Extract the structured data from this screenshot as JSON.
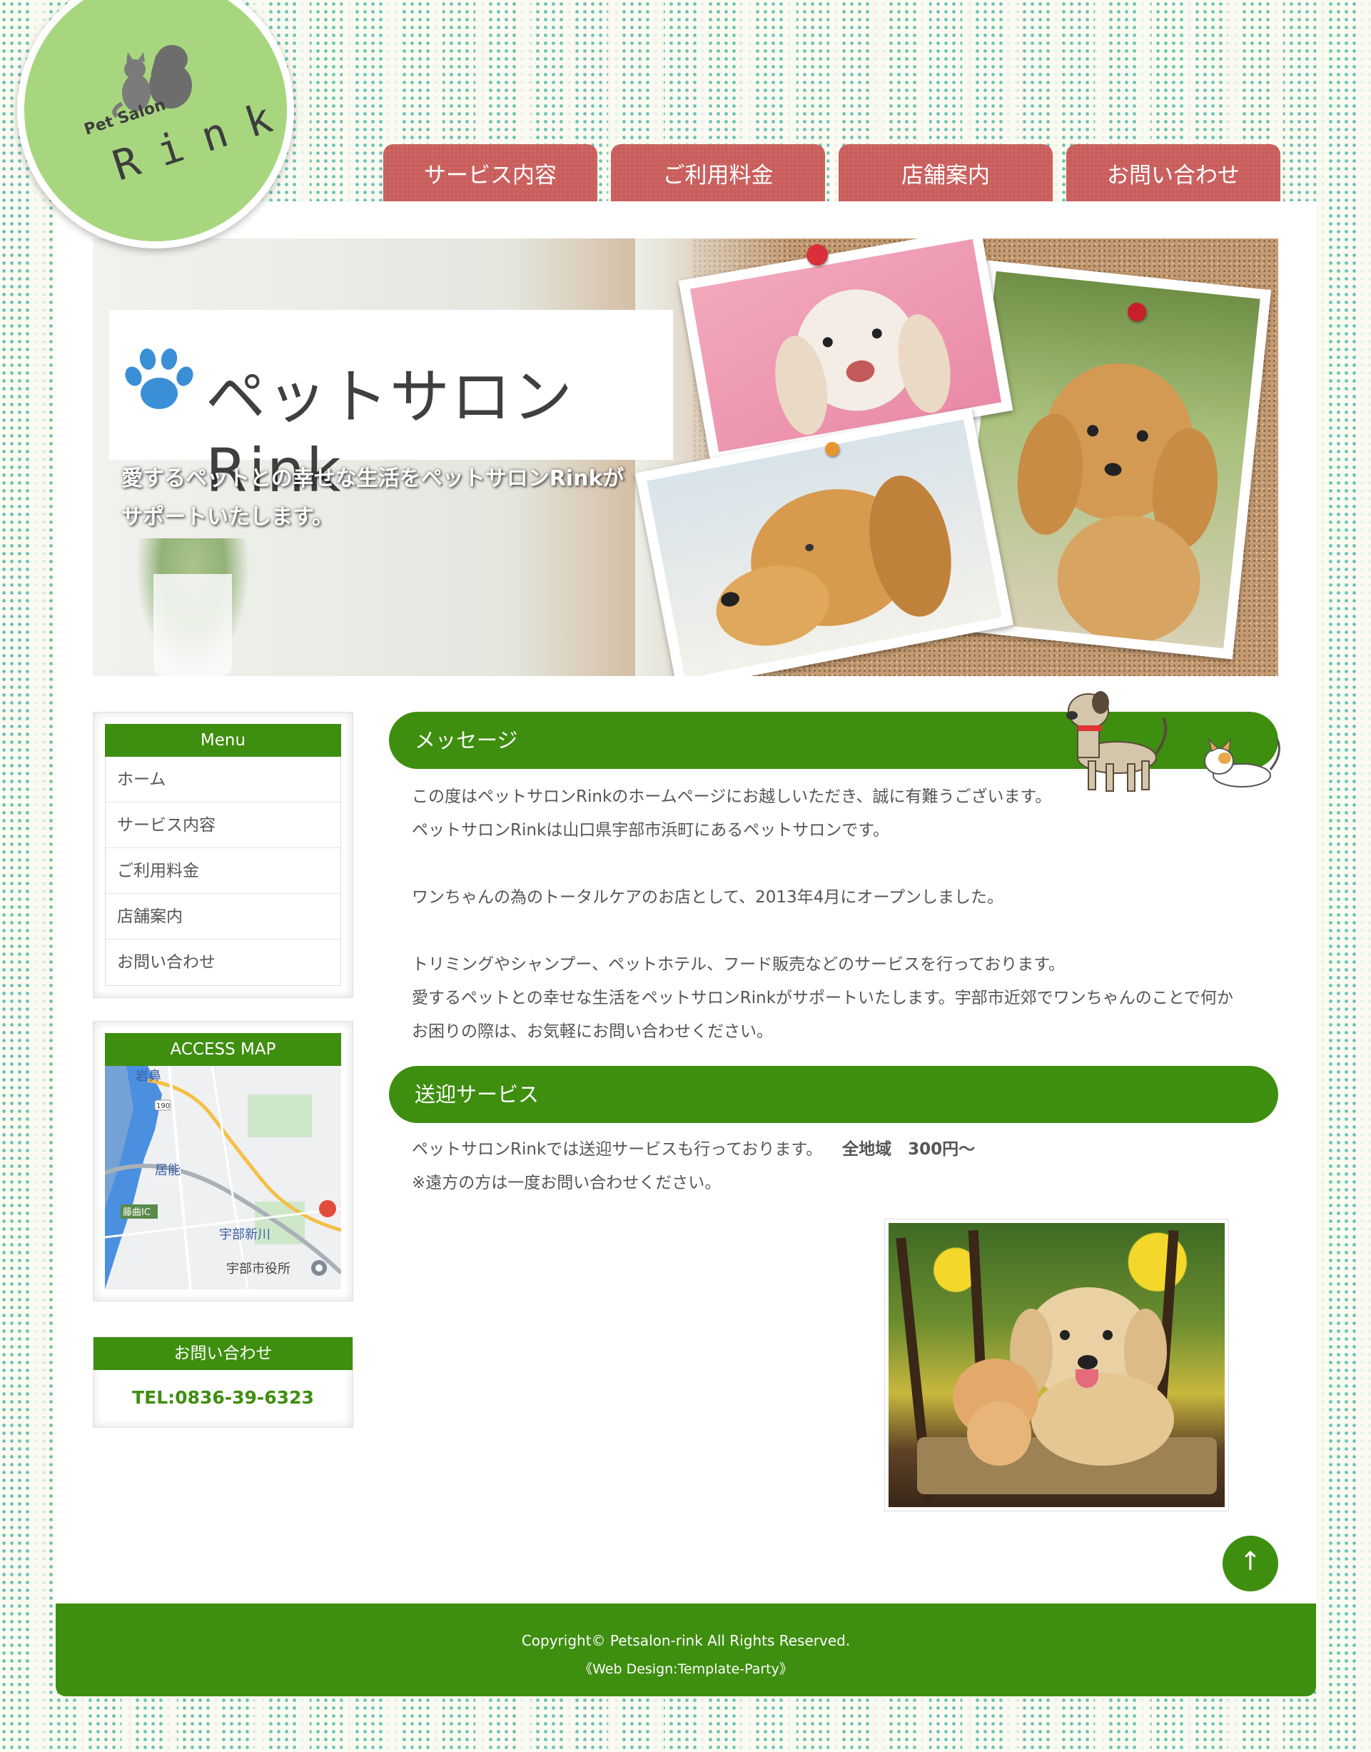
{
  "logo": {
    "sub": "Pet Salon",
    "main": "Rink"
  },
  "nav": [
    "サービス内容",
    "ご利用料金",
    "店舗案内",
    "お問い合わせ"
  ],
  "hero": {
    "title": "ペットサロン Rink",
    "caption": "愛するペットとの幸せな生活をペットサロンRinkが\nサポートいたします。"
  },
  "sidebar": {
    "menu_title": "Menu",
    "menu_items": [
      "ホーム",
      "サービス内容",
      "ご利用料金",
      "店舗案内",
      "お問い合わせ"
    ],
    "map_title": "ACCESS MAP",
    "map_labels": {
      "iwahana": "岩鼻",
      "route": "190",
      "ino": "居能",
      "ic": "藤曲IC",
      "ube_shinkawa": "宇部新川",
      "city_hall": "宇部市役所"
    },
    "contact_title": "お問い合わせ",
    "contact_tel": "TEL:0836-39-6323"
  },
  "main": {
    "message_title": "メッセージ",
    "message_lines": [
      "この度はペットサロンRinkのホームページにお越しいただき、誠に有難うございます。",
      "ペットサロンRinkは山口県宇部市浜町にあるペットサロンです。",
      "",
      "ワンちゃんの為のトータルケアのお店として、2013年4月にオープンしました。",
      "",
      "トリミングやシャンプー、ペットホテル、フード販売などのサービスを行っております。",
      "愛するペットとの幸せな生活をペットサロンRinkがサポートいたします。宇部市近郊でワンちゃんのことで何か",
      "お困りの際は、お気軽にお問い合わせください。"
    ],
    "pickup_title": "送迎サービス",
    "pickup_line1": "ペットサロンRinkでは送迎サービスも行っております。",
    "pickup_price": "全地域　300円〜",
    "pickup_line2": "※遠方の方は一度お問い合わせください。"
  },
  "to_top": "↑",
  "footer": {
    "copyright": "Copyright© Petsalon-rink All Rights Reserved.",
    "design": "《Web Design:Template-Party》"
  },
  "colors": {
    "brand_green": "#3e8e0f",
    "nav_red": "#c95e5c",
    "logo_green": "#a7d67f"
  }
}
